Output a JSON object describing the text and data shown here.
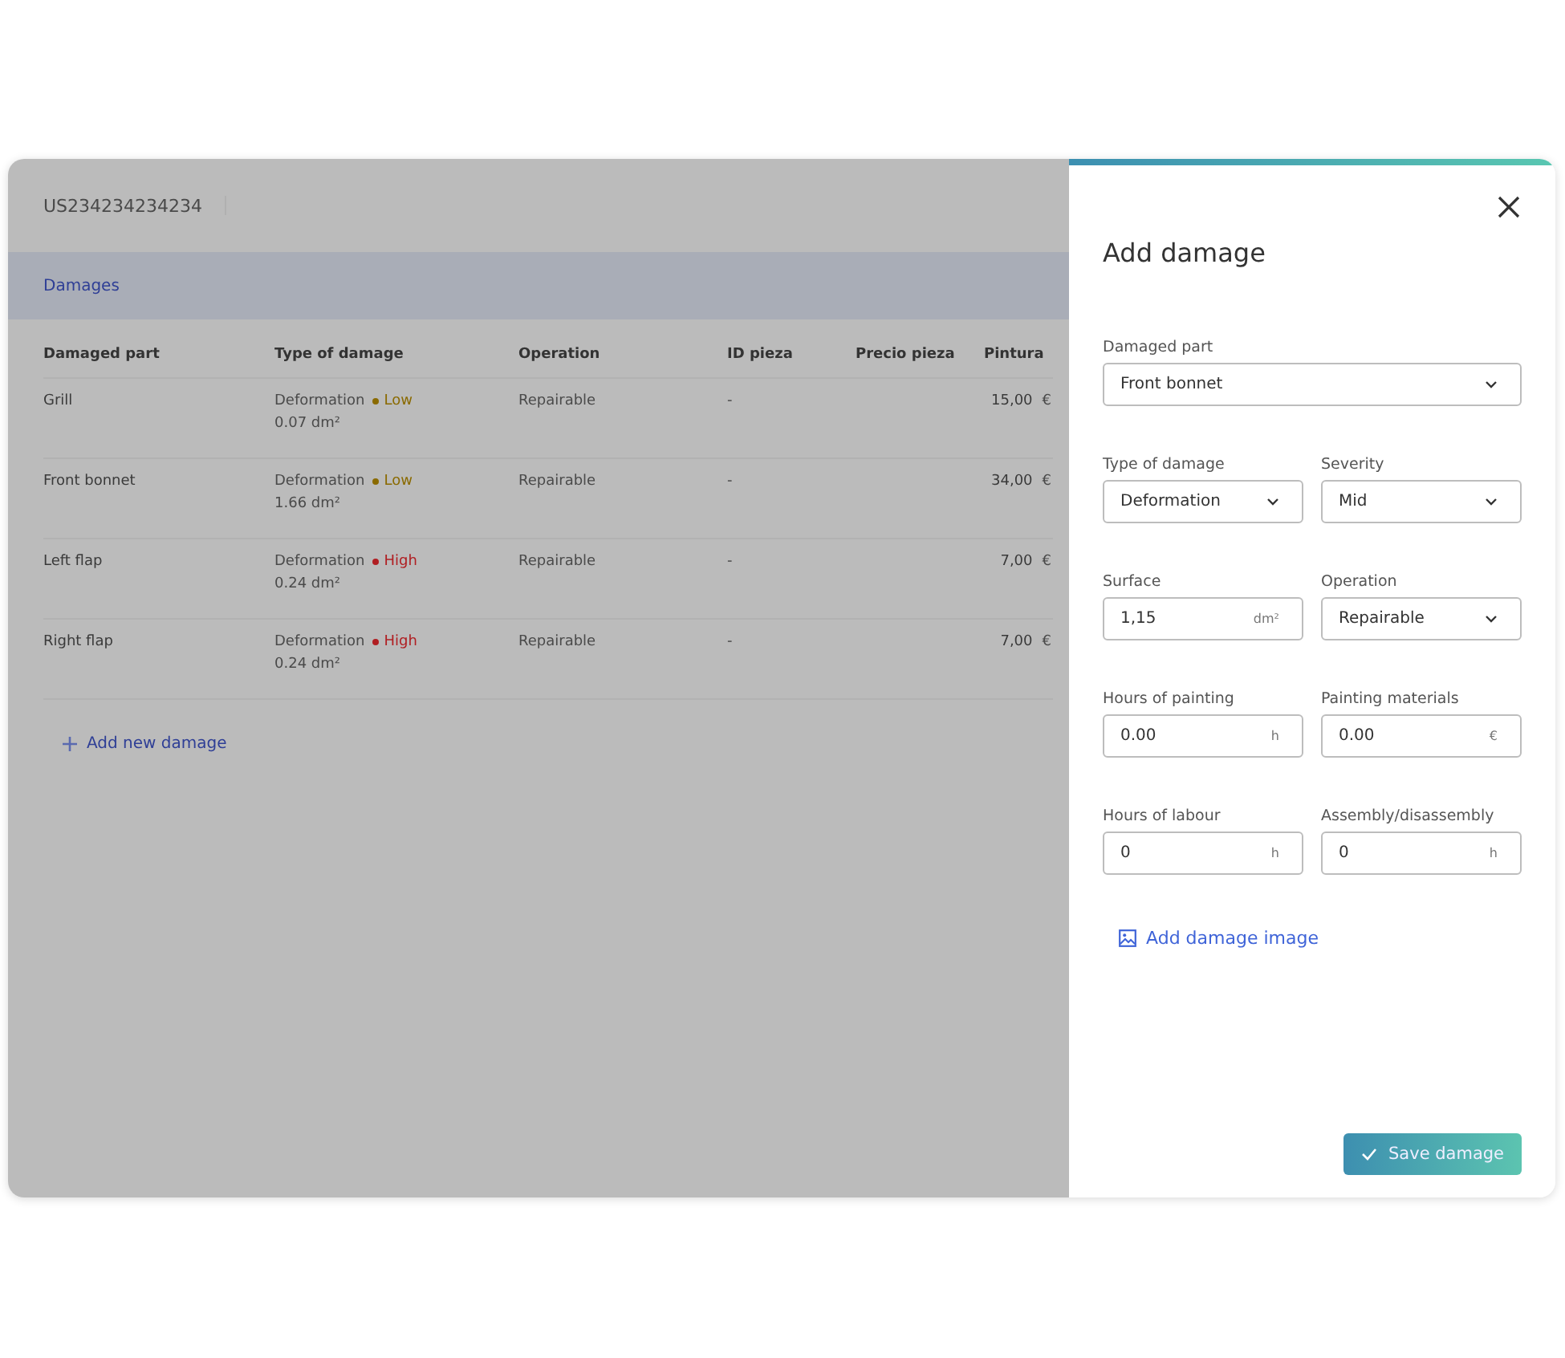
{
  "record": {
    "title": "US234234234234"
  },
  "section_tab": {
    "label": "Damages"
  },
  "table": {
    "columns": [
      "Damaged part",
      "Type of damage",
      "Operation",
      "ID pieza",
      "Precio pieza",
      "Pintura"
    ],
    "rows": [
      {
        "part": "Grill",
        "type": "Deformation",
        "severity": "Low",
        "color": "#8a6a00",
        "surface": "0.07 dm²",
        "operation": "Repairable",
        "id": "-",
        "price": "",
        "paint": "15,00",
        "currency": "€"
      },
      {
        "part": "Front bonnet",
        "type": "Deformation",
        "severity": "Low",
        "color": "#8a6a00",
        "surface": "1.66 dm²",
        "operation": "Repairable",
        "id": "-",
        "price": "",
        "paint": "34,00",
        "currency": "€"
      },
      {
        "part": "Left flap",
        "type": "Deformation",
        "severity": "High",
        "color": "#b01e22",
        "surface": "0.24 dm²",
        "operation": "Repairable",
        "id": "-",
        "price": "",
        "paint": "7,00",
        "currency": "€"
      },
      {
        "part": "Right flap",
        "type": "Deformation",
        "severity": "High",
        "color": "#b01e22",
        "surface": "0.24 dm²",
        "operation": "Repairable",
        "id": "-",
        "price": "",
        "paint": "7,00",
        "currency": "€"
      }
    ]
  },
  "add_link": {
    "label": "Add new damage"
  },
  "drawer": {
    "title": "Add damage",
    "field_rows": [
      [
        {
          "kind": "select",
          "label": "Damaged part",
          "value": "Front bonnet"
        }
      ],
      [
        {
          "kind": "select",
          "label": "Type of damage",
          "value": "Deformation"
        },
        {
          "kind": "select",
          "label": "Severity",
          "value": "Mid"
        }
      ],
      [
        {
          "kind": "text",
          "label": "Surface",
          "value": "1,15",
          "unit": "dm²"
        },
        {
          "kind": "select",
          "label": "Operation",
          "value": "Repairable"
        }
      ],
      [
        {
          "kind": "text",
          "label": "Hours of painting",
          "value": "0.00",
          "unit": "h"
        },
        {
          "kind": "text",
          "label": "Painting materials",
          "value": "0.00",
          "unit": "€"
        }
      ],
      [
        {
          "kind": "text",
          "label": "Hours of labour",
          "value": "0",
          "unit": "h"
        },
        {
          "kind": "text",
          "label": "Assembly/disassembly",
          "value": "0",
          "unit": "h"
        }
      ]
    ],
    "image_link": "Add damage image",
    "save_button": "Save damage"
  }
}
